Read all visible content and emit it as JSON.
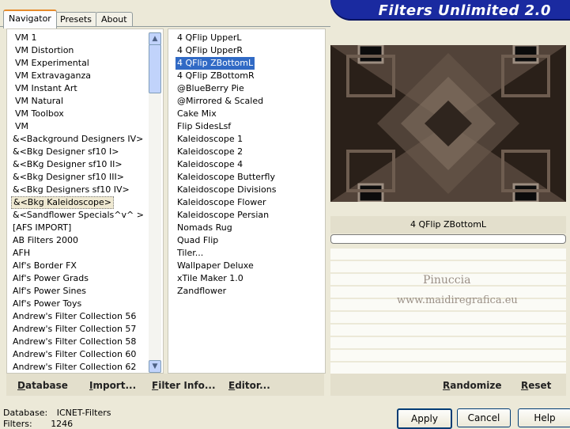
{
  "tabs": [
    "Navigator",
    "Presets",
    "About"
  ],
  "title": "Filters Unlimited 2.0",
  "categories": [
    "VM 1",
    "VM Distortion",
    "VM Experimental",
    "VM Extravaganza",
    "VM Instant Art",
    "VM Natural",
    "VM Toolbox",
    "VM",
    "&<Background Designers IV>",
    "&<Bkg Designer sf10 I>",
    "&<BKg Designer sf10 II>",
    "&<Bkg Designer sf10 III>",
    "&<Bkg Designers sf10 IV>",
    "&<Bkg Kaleidoscope>",
    "&<Sandflower Specials^v^ >",
    "[AFS IMPORT]",
    "AB Filters 2000",
    "AFH",
    "Alf's Border FX",
    "Alf's Power Grads",
    "Alf's Power Sines",
    "Alf's Power Toys",
    "Andrew's Filter Collection 56",
    "Andrew's Filter Collection 57",
    "Andrew's Filter Collection 58",
    "Andrew's Filter Collection 60",
    "Andrew's Filter Collection 62"
  ],
  "selected_category_index": 13,
  "filters": [
    "4 QFlip UpperL",
    "4 QFlip UpperR",
    "4 QFlip ZBottomL",
    "4 QFlip ZBottomR",
    "@BlueBerry Pie",
    "@Mirrored & Scaled",
    "Cake Mix",
    "Flip SidesLsf",
    "Kaleidoscope 1",
    "Kaleidoscope 2",
    "Kaleidoscope 4",
    "Kaleidoscope Butterfly",
    "Kaleidoscope Divisions",
    "Kaleidoscope Flower",
    "Kaleidoscope Persian",
    "Nomads Rug",
    "Quad Flip",
    "Tiler...",
    "Wallpaper Deluxe",
    "xTile Maker 1.0",
    "Zandflower"
  ],
  "selected_filter_index": 2,
  "preview": {
    "filter_name": "4 QFlip ZBottomL"
  },
  "watermark": {
    "line1": "Pinuccia",
    "line2": "www.maidiregrafica.eu"
  },
  "left_bar": {
    "database": "Database",
    "import": "Import...",
    "filter_info": "Filter Info...",
    "editor": "Editor..."
  },
  "right_bar": {
    "randomize": "Randomize",
    "reset": "Reset"
  },
  "status": {
    "database_label": "Database:",
    "database_value": "ICNET-Filters",
    "filters_label": "Filters:",
    "filters_value": "1246"
  },
  "buttons": {
    "apply": "Apply",
    "cancel": "Cancel",
    "help": "Help"
  },
  "colors": {
    "title_bg": "#1a2aa0",
    "selection": "#316ac5",
    "preview_base": "#3b3029"
  },
  "icons": {
    "scroll_up": "▲",
    "scroll_down": "▼"
  }
}
